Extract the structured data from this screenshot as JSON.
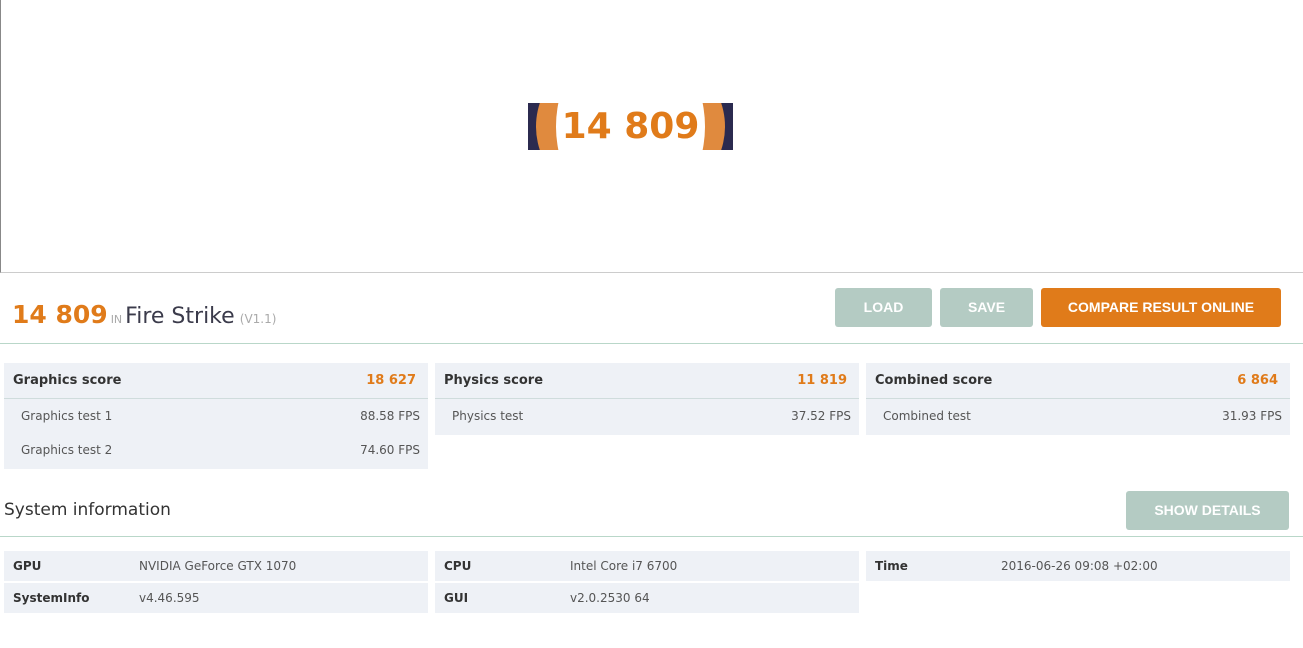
{
  "hero": {
    "score": "14 809"
  },
  "title": {
    "score": "14 809",
    "in": "IN",
    "name": "Fire Strike",
    "version": "(V1.1)"
  },
  "buttons": {
    "load": "LOAD",
    "save": "SAVE",
    "compare": "COMPARE RESULT ONLINE",
    "show_details": "SHOW DETAILS"
  },
  "cards": [
    {
      "label": "Graphics score",
      "value": "18 627",
      "rows": [
        {
          "label": "Graphics test 1",
          "value": "88.58 FPS"
        },
        {
          "label": "Graphics test 2",
          "value": "74.60 FPS"
        }
      ]
    },
    {
      "label": "Physics score",
      "value": "11 819",
      "rows": [
        {
          "label": "Physics test",
          "value": "37.52 FPS"
        }
      ]
    },
    {
      "label": "Combined score",
      "value": "6 864",
      "rows": [
        {
          "label": "Combined test",
          "value": "31.93 FPS"
        }
      ]
    }
  ],
  "system": {
    "title": "System information",
    "items": [
      {
        "label": "GPU",
        "value": "NVIDIA GeForce GTX 1070"
      },
      {
        "label": "SystemInfo",
        "value": "v4.46.595"
      },
      {
        "label": "CPU",
        "value": "Intel Core i7 6700"
      },
      {
        "label": "GUI",
        "value": "v2.0.2530 64"
      },
      {
        "label": "Time",
        "value": "2016-06-26 09:08 +02:00"
      }
    ]
  }
}
